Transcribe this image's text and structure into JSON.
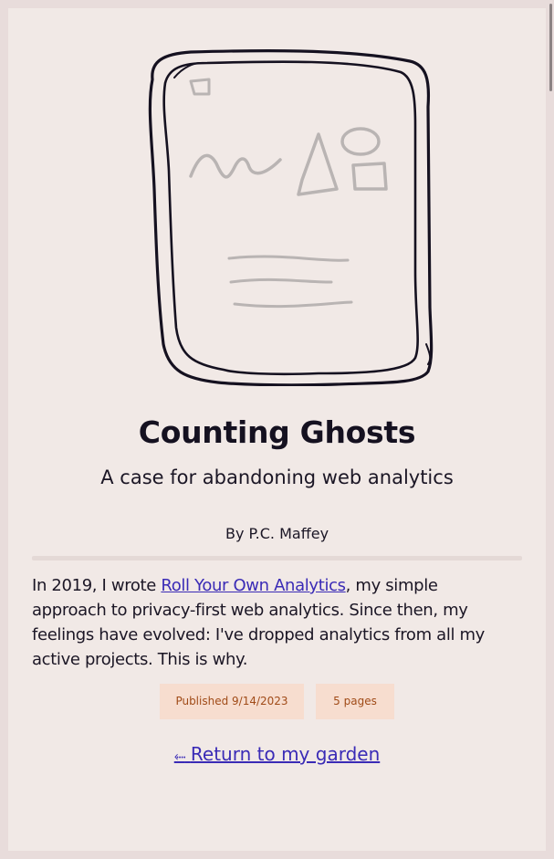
{
  "post": {
    "title": "Counting Ghosts",
    "subtitle": "A case for abandoning web analytics",
    "byline": "By P.C. Maffey",
    "summary": {
      "intro": "In 2019, I wrote ",
      "link_text": "Roll Your Own Analytics",
      "rest": ", my simple approach to privacy-first web analytics. Since then, my feelings have evolved: I've dropped analytics from all my active projects. This is why."
    },
    "tags": {
      "published": "Published 9/14/2023",
      "pages": "5 pages"
    }
  },
  "nav": {
    "return_arrow": "⬸",
    "return_label": "Return to my garden"
  },
  "colors": {
    "background": "#e8dcdb",
    "page": "#f1e9e6",
    "link": "#3a2bb6",
    "tag_bg": "#f7ddcf",
    "tag_text": "#a04b18"
  }
}
